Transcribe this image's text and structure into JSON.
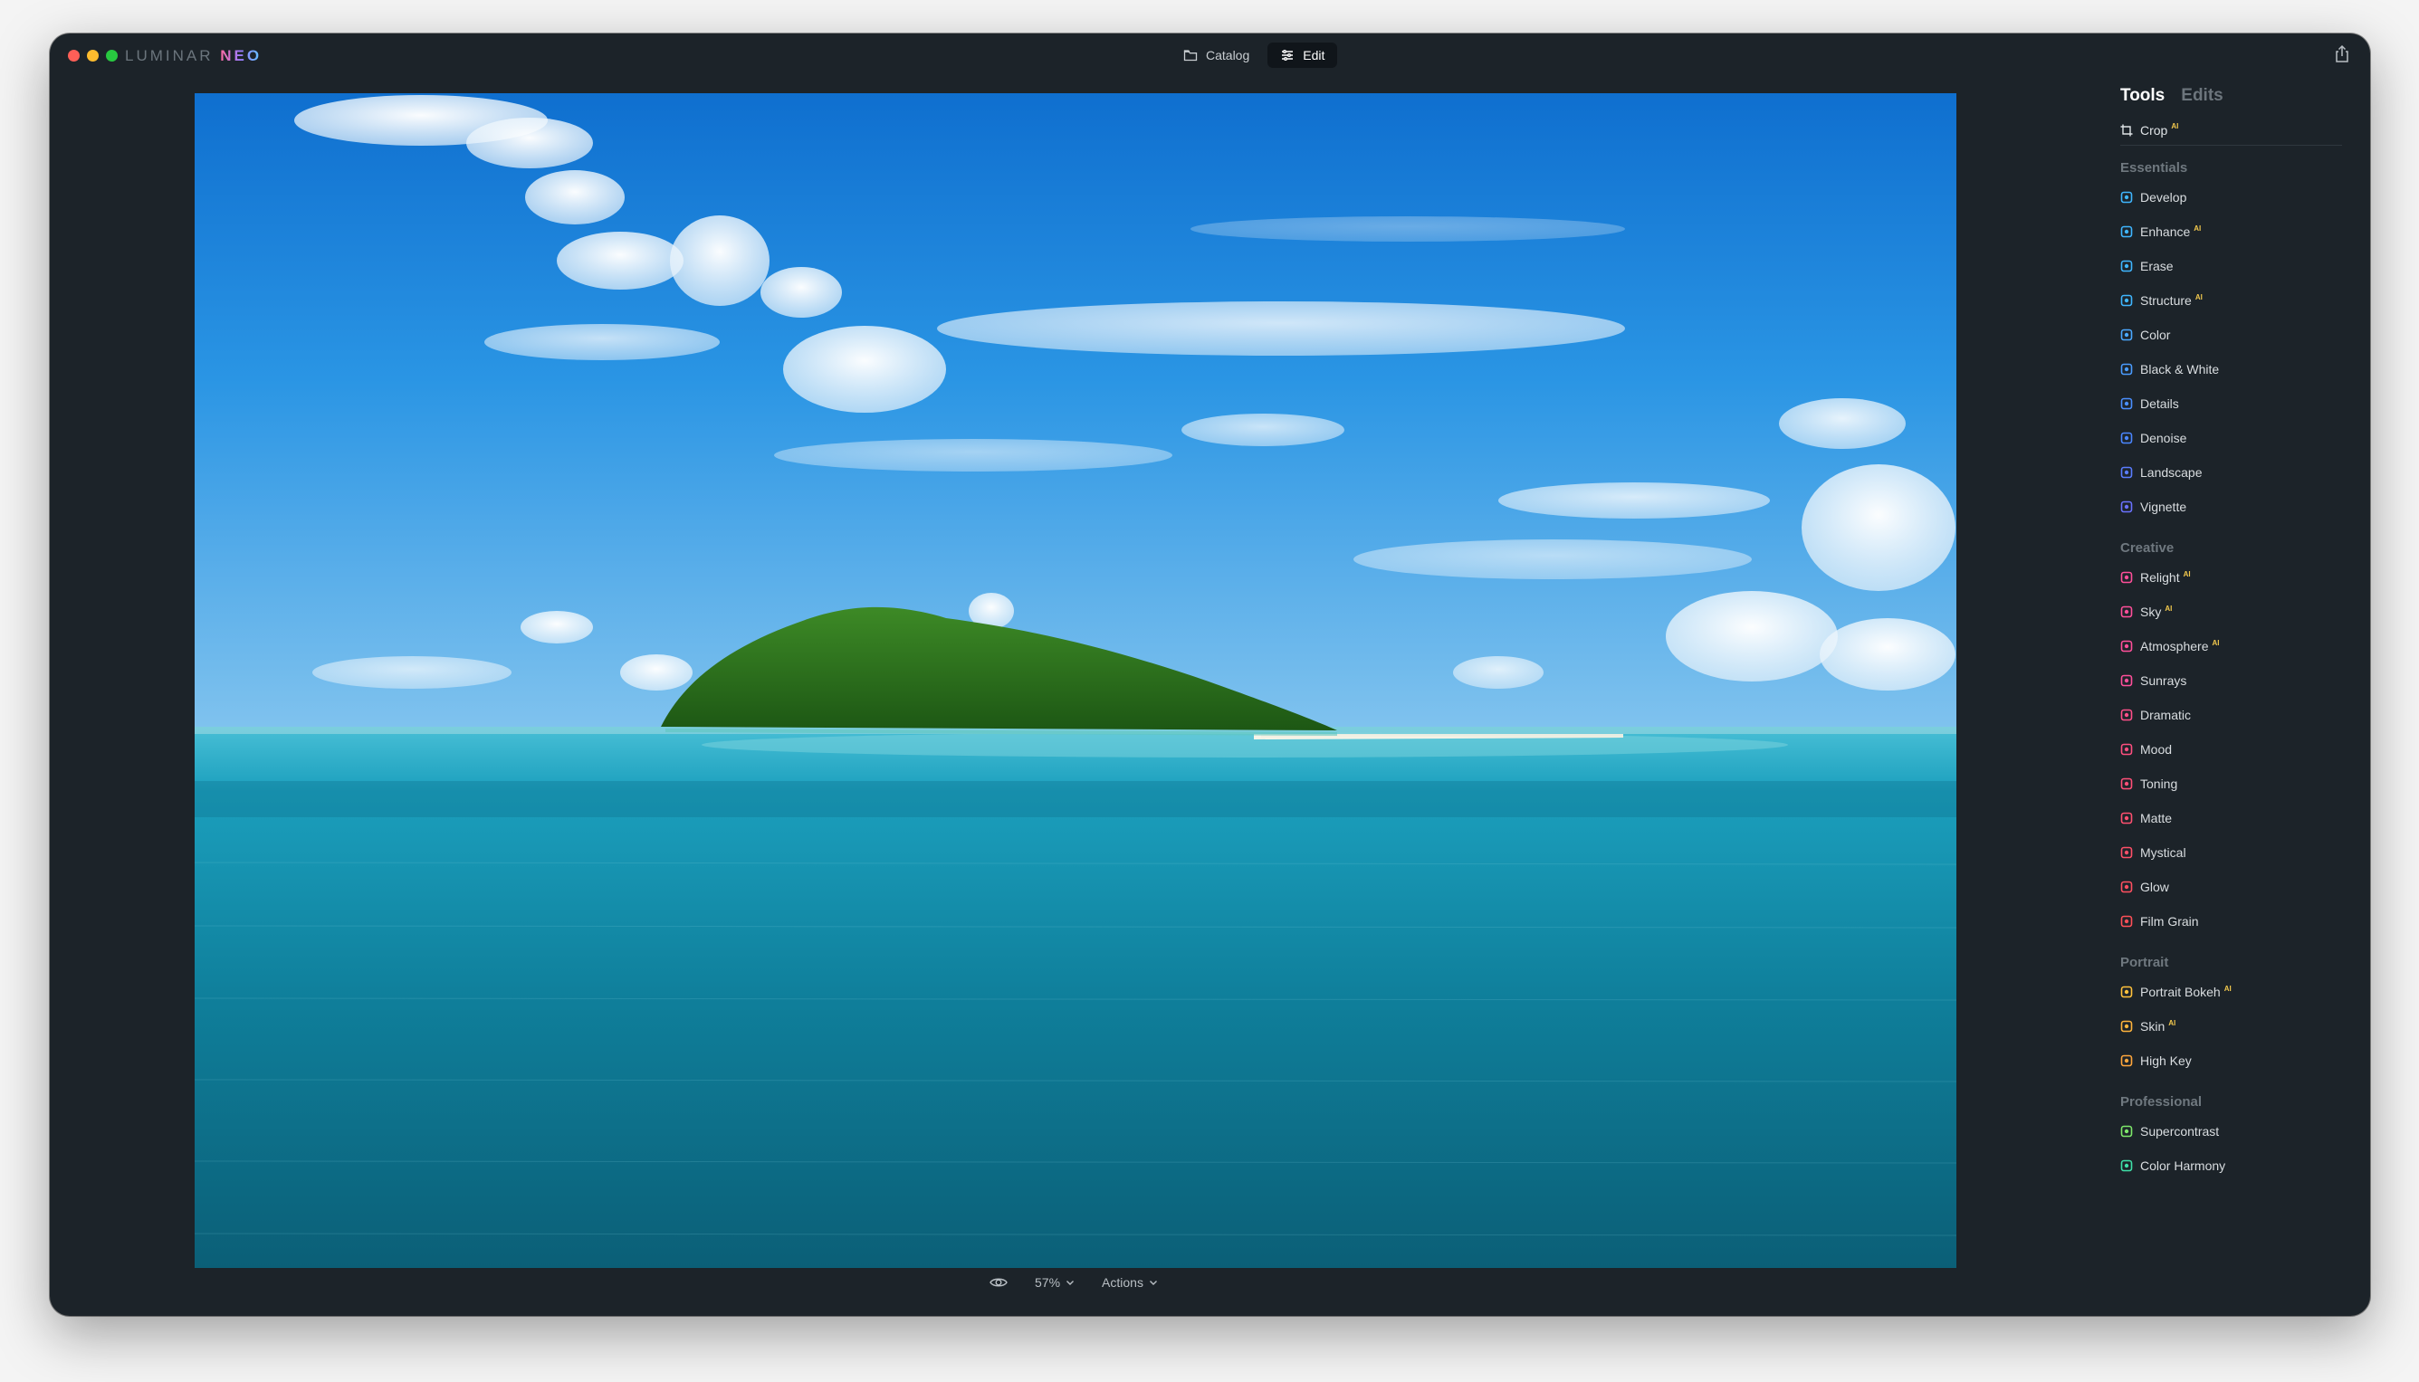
{
  "app": {
    "logo_main": "LUMINAR",
    "logo_accent": "NEO"
  },
  "modes": {
    "catalog": "Catalog",
    "edit": "Edit"
  },
  "bottombar": {
    "zoom": "57%",
    "actions": "Actions"
  },
  "panel": {
    "tabs": [
      "Tools",
      "Edits"
    ],
    "crop": {
      "label": "Crop",
      "badge": "AI"
    },
    "groups": [
      {
        "title": "Essentials",
        "tools": [
          {
            "label": "Develop",
            "icon": "develop-icon",
            "color": "#3fb6ff",
            "badge": ""
          },
          {
            "label": "Enhance",
            "icon": "enhance-icon",
            "color": "#3fb6ff",
            "badge": "AI"
          },
          {
            "label": "Erase",
            "icon": "erase-icon",
            "color": "#3fb6ff",
            "badge": ""
          },
          {
            "label": "Structure",
            "icon": "structure-icon",
            "color": "#3fb6ff",
            "badge": "AI"
          },
          {
            "label": "Color",
            "icon": "color-icon",
            "color": "#4aa8ff",
            "badge": ""
          },
          {
            "label": "Black & White",
            "icon": "black-white-icon",
            "color": "#4a9cff",
            "badge": ""
          },
          {
            "label": "Details",
            "icon": "details-icon",
            "color": "#4a8fff",
            "badge": ""
          },
          {
            "label": "Denoise",
            "icon": "denoise-icon",
            "color": "#4a86ff",
            "badge": ""
          },
          {
            "label": "Landscape",
            "icon": "landscape-icon",
            "color": "#5a7dff",
            "badge": ""
          },
          {
            "label": "Vignette",
            "icon": "vignette-icon",
            "color": "#6a72ff",
            "badge": ""
          }
        ]
      },
      {
        "title": "Creative",
        "tools": [
          {
            "label": "Relight",
            "icon": "relight-icon",
            "color": "#ff4f9a",
            "badge": "AI"
          },
          {
            "label": "Sky",
            "icon": "sky-icon",
            "color": "#ff4f9a",
            "badge": "AI"
          },
          {
            "label": "Atmosphere",
            "icon": "atmosphere-icon",
            "color": "#ff4f9a",
            "badge": "AI"
          },
          {
            "label": "Sunrays",
            "icon": "sunrays-icon",
            "color": "#ff4f9a",
            "badge": ""
          },
          {
            "label": "Dramatic",
            "icon": "dramatic-icon",
            "color": "#ff4f8a",
            "badge": ""
          },
          {
            "label": "Mood",
            "icon": "mood-icon",
            "color": "#ff4f80",
            "badge": ""
          },
          {
            "label": "Toning",
            "icon": "toning-icon",
            "color": "#ff5078",
            "badge": ""
          },
          {
            "label": "Matte",
            "icon": "matte-icon",
            "color": "#ff5070",
            "badge": ""
          },
          {
            "label": "Mystical",
            "icon": "mystical-icon",
            "color": "#ff5068",
            "badge": ""
          },
          {
            "label": "Glow",
            "icon": "glow-icon",
            "color": "#ff5060",
            "badge": ""
          },
          {
            "label": "Film Grain",
            "icon": "film-grain-icon",
            "color": "#ff5058",
            "badge": ""
          }
        ]
      },
      {
        "title": "Portrait",
        "tools": [
          {
            "label": "Portrait Bokeh",
            "icon": "portrait-bokeh-icon",
            "color": "#ffc23c",
            "badge": "AI"
          },
          {
            "label": "Skin",
            "icon": "skin-icon",
            "color": "#ffb43c",
            "badge": "AI"
          },
          {
            "label": "High Key",
            "icon": "high-key-icon",
            "color": "#ffa63c",
            "badge": ""
          }
        ]
      },
      {
        "title": "Professional",
        "tools": [
          {
            "label": "Supercontrast",
            "icon": "supercontrast-icon",
            "color": "#7ee86a",
            "badge": ""
          },
          {
            "label": "Color Harmony",
            "icon": "color-harmony-icon",
            "color": "#3fe0a8",
            "badge": ""
          }
        ]
      }
    ]
  }
}
